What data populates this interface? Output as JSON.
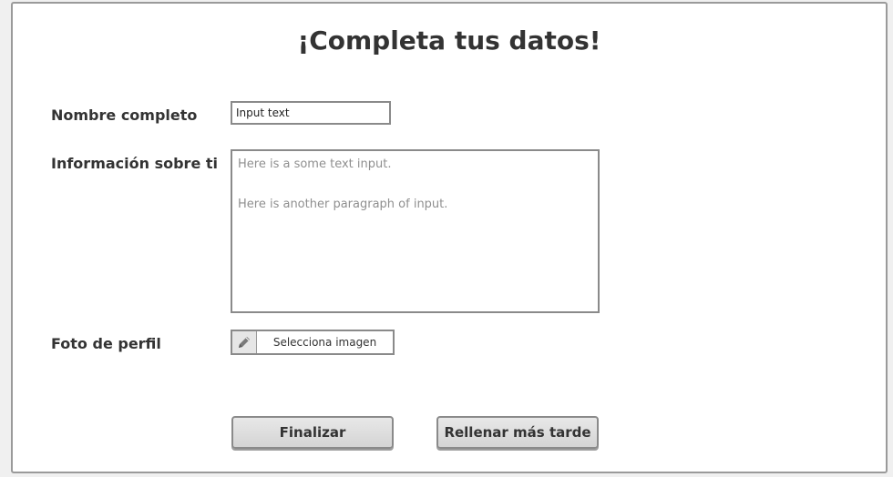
{
  "form": {
    "title": "¡Completa tus datos!",
    "name_label": "Nombre completo",
    "name_value": "Input text",
    "about_label": "Información sobre ti",
    "about_paragraphs": [
      "Here is a some text input.",
      "Here is another paragraph of input."
    ],
    "photo_label": "Foto de perfil",
    "photo_button_label": "Selecciona imagen",
    "photo_icon": "pencil-icon"
  },
  "actions": {
    "finish_label": "Finalizar",
    "later_label": "Rellenar más tarde"
  },
  "colors": {
    "panel_border": "#9a9a9a",
    "text": "#333333",
    "placeholder_text": "#8f8f8f",
    "button_fill": "#dddddd"
  }
}
